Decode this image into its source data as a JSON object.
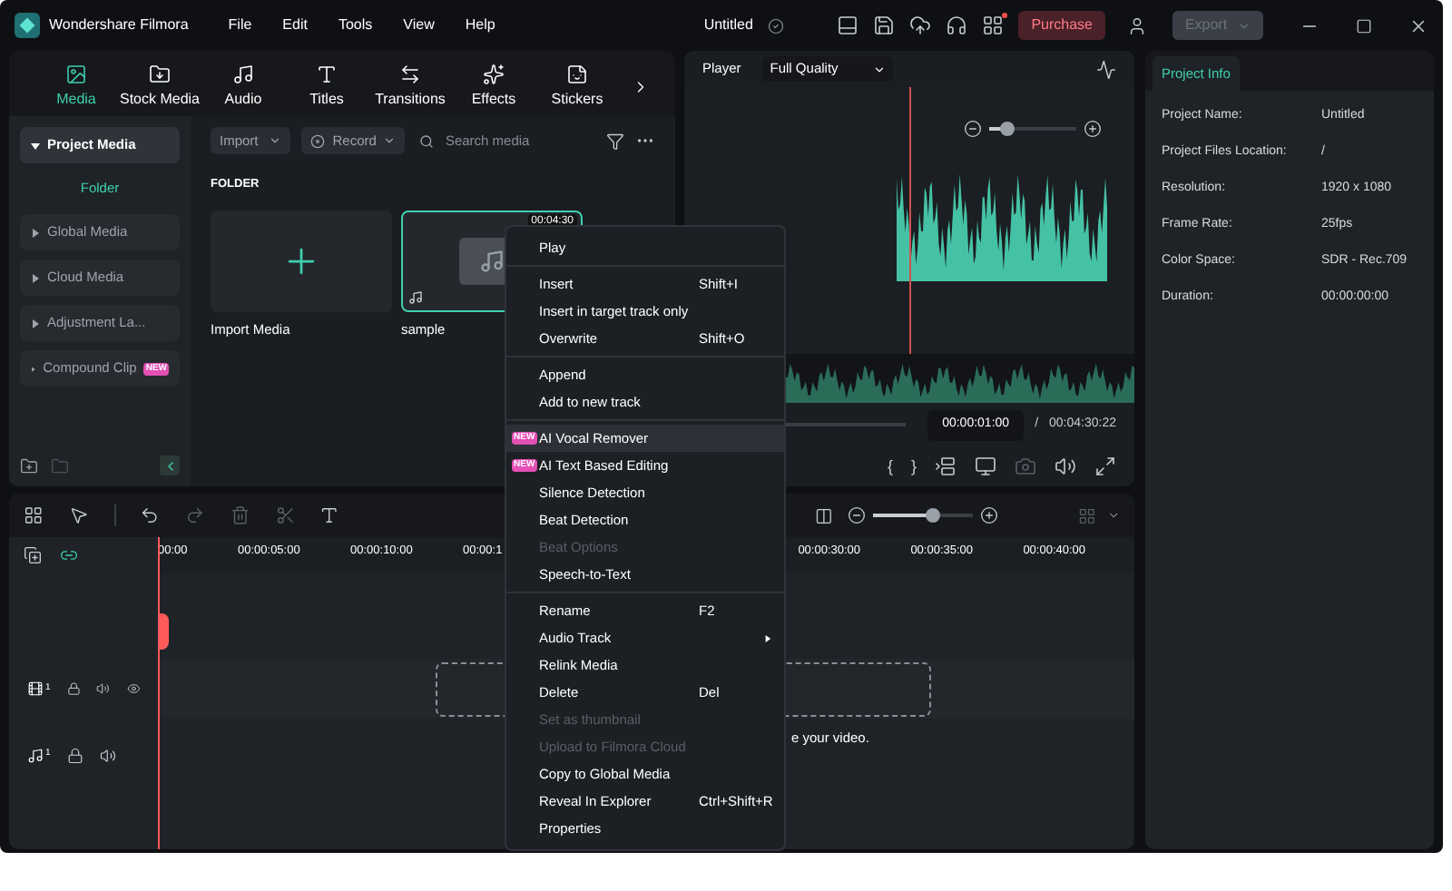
{
  "app": {
    "name": "Wondershare Filmora"
  },
  "menu_bar": [
    "File",
    "Edit",
    "Tools",
    "View",
    "Help"
  ],
  "title": "Untitled",
  "purchase": "Purchase",
  "export": {
    "label": "Export",
    "disabled": true
  },
  "media_tabs": [
    {
      "label": "Media",
      "selected": true
    },
    {
      "label": "Stock Media",
      "selected": false
    },
    {
      "label": "Audio",
      "selected": false
    },
    {
      "label": "Titles",
      "selected": false
    },
    {
      "label": "Transitions",
      "selected": false
    },
    {
      "label": "Effects",
      "selected": false
    },
    {
      "label": "Stickers",
      "selected": false
    }
  ],
  "sidebar": {
    "items": [
      {
        "label": "Project Media",
        "selected": true,
        "expanded": true,
        "children": [
          {
            "label": "Folder",
            "selected": true
          }
        ]
      },
      {
        "label": "Global Media",
        "selected": false,
        "expanded": false
      },
      {
        "label": "Cloud Media",
        "selected": false,
        "expanded": false
      },
      {
        "label": "Adjustment La...",
        "selected": false,
        "expanded": false
      },
      {
        "label": "Compound Clip",
        "selected": false,
        "expanded": false,
        "badge": "NEW"
      }
    ]
  },
  "media_toolbar": {
    "import": "Import",
    "record": "Record",
    "search": {
      "placeholder": "Search media"
    }
  },
  "folder_heading": "FOLDER",
  "media_items": [
    {
      "kind": "import",
      "label": "Import Media",
      "selected": false
    },
    {
      "kind": "audio",
      "label": "sample",
      "duration": "00:04:30",
      "selected": true
    }
  ],
  "player": {
    "tab": "Player",
    "quality": "Full Quality",
    "zoom": {
      "level": 0.2
    },
    "mark_in": "{",
    "mark_out": "}",
    "current_time": "00:00:01:00",
    "separator": "/",
    "total_time": "00:04:30:22"
  },
  "project_info": {
    "tab": "Project Info",
    "fields": [
      {
        "label": "Project Name:",
        "value": "Untitled"
      },
      {
        "label": "Project Files Location:",
        "value": "/"
      },
      {
        "label": "Resolution:",
        "value": "1920 x 1080"
      },
      {
        "label": "Frame Rate:",
        "value": "25fps"
      },
      {
        "label": "Color Space:",
        "value": "SDR - Rec.709"
      },
      {
        "label": "Duration:",
        "value": "00:00:00:00"
      }
    ]
  },
  "timeline": {
    "zoom": {
      "level": 0.6
    },
    "ruler_left": [
      "00:00",
      "00:00:05:00",
      "00:00:10:00",
      "00:00:1"
    ],
    "ruler_right": [
      "00:00:30:00",
      "00:00:35:00",
      "00:00:40:00"
    ],
    "tracks": [
      {
        "kind": "video",
        "number": "1"
      },
      {
        "kind": "audio",
        "number": "1"
      }
    ],
    "drop_hint": "e your video."
  },
  "context_menu": [
    [
      {
        "label": "Play",
        "disabled": false,
        "selected": false
      }
    ],
    [
      {
        "label": "Insert",
        "shortcut": "Shift+I",
        "disabled": false,
        "selected": false
      },
      {
        "label": "Insert in target track only",
        "disabled": false,
        "selected": false
      },
      {
        "label": "Overwrite",
        "shortcut": "Shift+O",
        "disabled": false,
        "selected": false
      }
    ],
    [
      {
        "label": "Append",
        "disabled": false,
        "selected": false
      },
      {
        "label": "Add to new track",
        "disabled": false,
        "selected": false
      }
    ],
    [
      {
        "label": "AI Vocal Remover",
        "badge": "NEW",
        "disabled": false,
        "selected": true
      },
      {
        "label": "AI Text Based Editing",
        "badge": "NEW",
        "disabled": false,
        "selected": false
      },
      {
        "label": "Silence Detection",
        "disabled": false,
        "selected": false
      },
      {
        "label": "Beat Detection",
        "disabled": false,
        "selected": false
      },
      {
        "label": "Beat Options",
        "disabled": true,
        "selected": false
      },
      {
        "label": "Speech-to-Text",
        "disabled": false,
        "selected": false
      }
    ],
    [
      {
        "label": "Rename",
        "shortcut": "F2",
        "disabled": false,
        "selected": false
      },
      {
        "label": "Audio Track",
        "submenu": true,
        "disabled": false,
        "selected": false
      },
      {
        "label": "Relink Media",
        "disabled": false,
        "selected": false
      },
      {
        "label": "Delete",
        "shortcut": "Del",
        "disabled": false,
        "selected": false
      },
      {
        "label": "Set as thumbnail",
        "disabled": true,
        "selected": false
      },
      {
        "label": "Upload to Filmora Cloud",
        "disabled": true,
        "selected": false
      },
      {
        "label": "Copy to Global Media",
        "disabled": false,
        "selected": false
      },
      {
        "label": "Reveal In Explorer",
        "shortcut": "Ctrl+Shift+R",
        "disabled": false,
        "selected": false
      },
      {
        "label": "Properties",
        "disabled": false,
        "selected": false
      }
    ]
  ]
}
